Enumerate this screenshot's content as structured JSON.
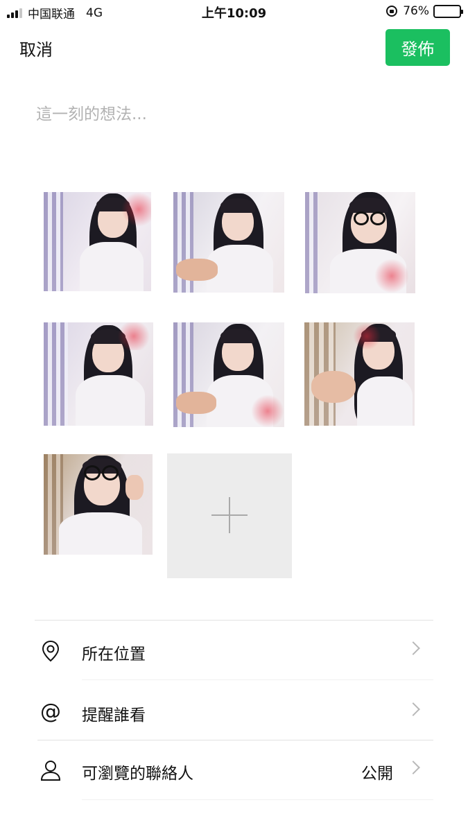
{
  "status_bar": {
    "carrier": "中国联通",
    "network": "4G",
    "time": "上午10:09",
    "battery": "76%",
    "battery_level": 0.76
  },
  "header": {
    "cancel_label": "取消",
    "publish_label": "發佈",
    "publish_color": "#1bbf60"
  },
  "composer": {
    "placeholder": "這一刻的想法..."
  },
  "photos": {
    "count": 7,
    "add_icon": "plus-icon"
  },
  "options": [
    {
      "icon": "location-pin-icon",
      "label": "所在位置",
      "value": ""
    },
    {
      "icon": "at-icon",
      "label": "提醒誰看",
      "value": ""
    },
    {
      "icon": "person-icon",
      "label": "可瀏覽的聯絡人",
      "value": "公開"
    }
  ]
}
